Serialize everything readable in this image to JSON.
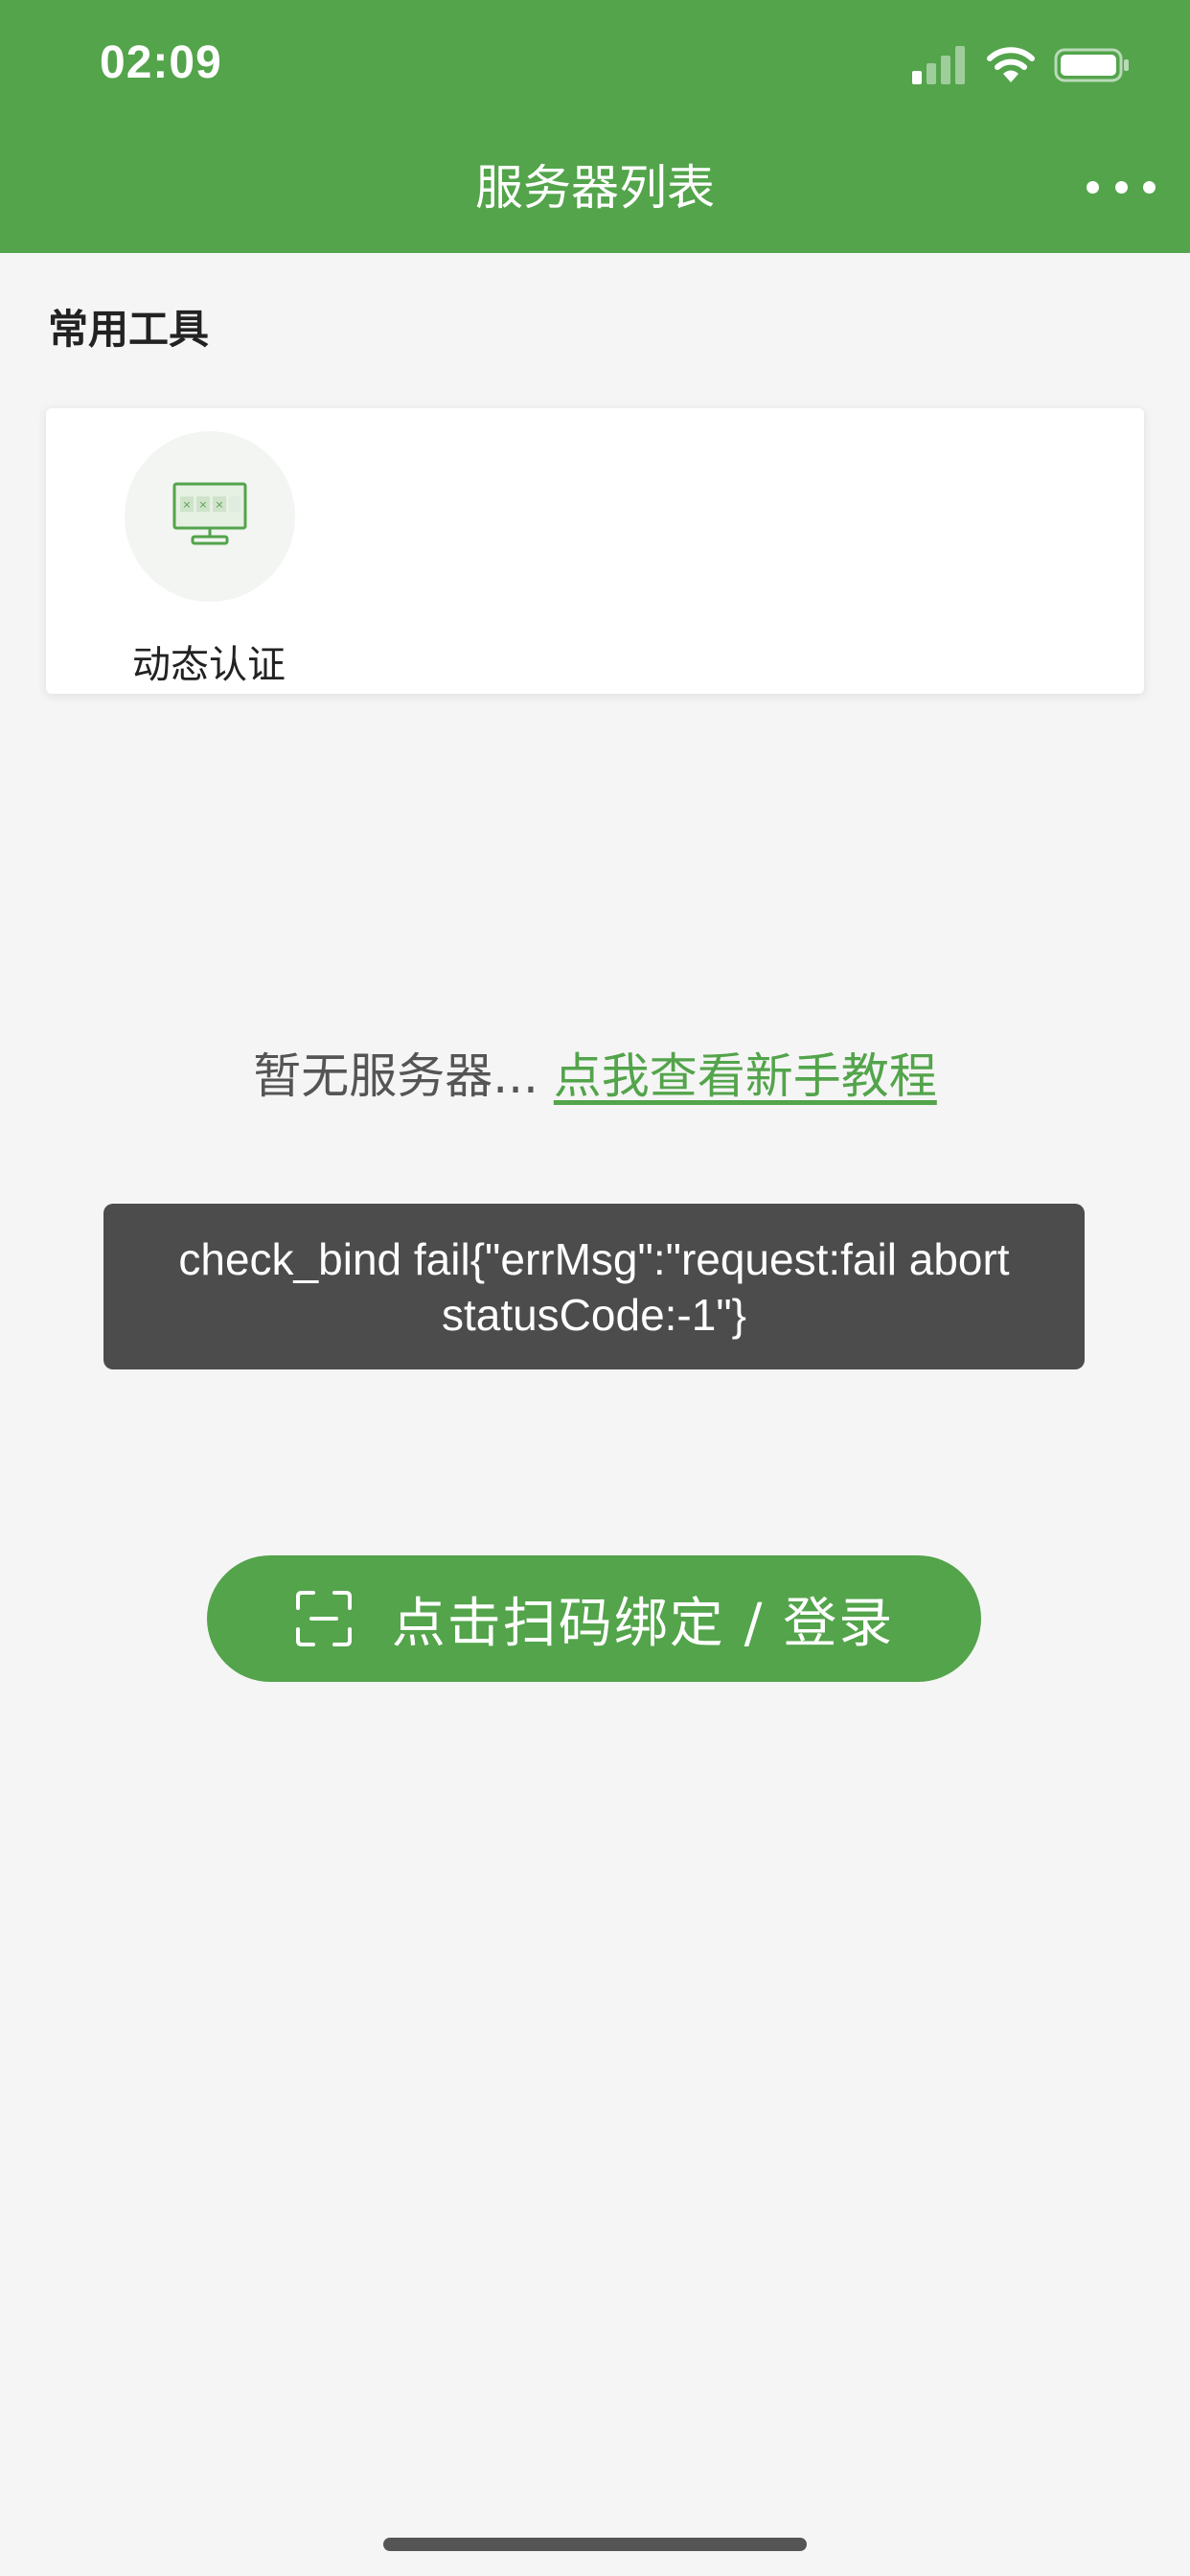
{
  "status_bar": {
    "time": "02:09"
  },
  "nav": {
    "title": "服务器列表"
  },
  "tools_section": {
    "title": "常用工具",
    "items": [
      {
        "label": "动态认证",
        "icon": "monitor-icon"
      }
    ]
  },
  "empty_state": {
    "text": "暂无服务器...",
    "link_label": "点我查看新手教程"
  },
  "toast": {
    "message": "check_bind fail{\"errMsg\":\"request:fail abort statusCode:-1\"}"
  },
  "scan_button": {
    "label": "点击扫码绑定 / 登录",
    "icon": "scan-icon"
  },
  "colors": {
    "brand": "#53a44b",
    "background": "#f5f5f5",
    "toast_bg": "#4c4c4c"
  }
}
